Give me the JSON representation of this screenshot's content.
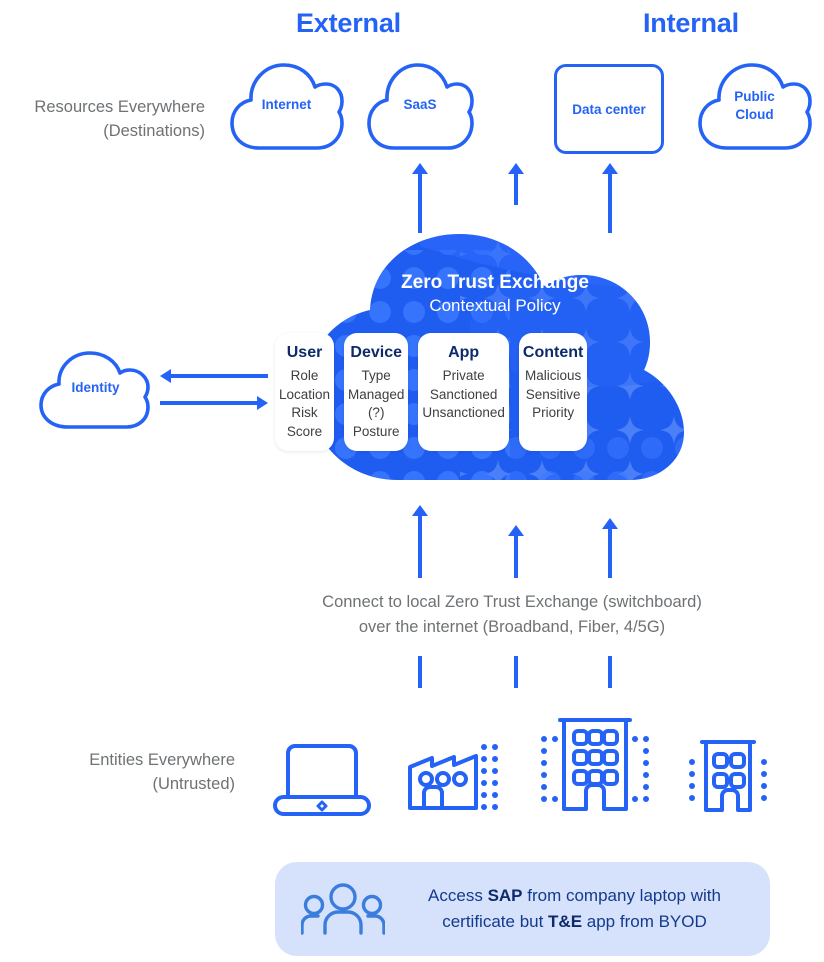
{
  "zones": {
    "external_label": "External",
    "internal_label": "Internal"
  },
  "rows": {
    "resources": {
      "line1": "Resources Everywhere",
      "line2": "(Destinations)"
    },
    "entities": {
      "line1": "Entities Everywhere",
      "line2": "(Untrusted)"
    }
  },
  "destinations": [
    {
      "id": "internet",
      "label": "Internet",
      "shape": "cloud"
    },
    {
      "id": "saas",
      "label": "SaaS",
      "shape": "cloud"
    },
    {
      "id": "datacenter",
      "label": "Data center",
      "shape": "rect"
    },
    {
      "id": "public-cloud",
      "label": "Public\nCloud",
      "shape": "cloud"
    }
  ],
  "destination_labels": {
    "internet": "Internet",
    "saas": "SaaS",
    "datacenter": "Data center",
    "public_cloud_line1": "Public",
    "public_cloud_line2": "Cloud"
  },
  "identity": {
    "label": "Identity"
  },
  "exchange": {
    "title": "Zero Trust Exchange",
    "subtitle": "Contextual Policy",
    "cards": [
      {
        "title": "User",
        "items": [
          "Role",
          "Location",
          "Risk Score"
        ]
      },
      {
        "title": "Device",
        "items": [
          "Type",
          "Managed (?)",
          "Posture"
        ]
      },
      {
        "title": "App",
        "items": [
          "Private",
          "Sanctioned",
          "Unsanctioned"
        ]
      },
      {
        "title": "Content",
        "items": [
          "Malicious",
          "Sensitive",
          "Priority"
        ]
      }
    ]
  },
  "connect_caption": {
    "line1": "Connect to local Zero Trust Exchange (switchboard)",
    "line2": "over the internet (Broadband, Fiber, 4/5G)"
  },
  "entities": [
    {
      "id": "laptop",
      "icon": "laptop-icon"
    },
    {
      "id": "factory",
      "icon": "factory-icon"
    },
    {
      "id": "building-lg",
      "icon": "office-building-icon"
    },
    {
      "id": "building-sm",
      "icon": "small-building-icon"
    }
  ],
  "callout": {
    "icon": "people-group-icon",
    "line1_pre": "Access ",
    "line1_bold": "SAP",
    "line1_post": " from company laptop with",
    "line2_pre": "certificate but ",
    "line2_bold": "T&E",
    "line2_post": " app from BYOD"
  },
  "colors": {
    "brand_blue": "#2463f5",
    "cloud_fill": "#1f5cf0",
    "cloud_fill_light": "#3a78ff",
    "card_title": "#0d2a6b",
    "card_text": "#3c4043",
    "gray_label": "#6e7275",
    "callout_bg": "#d6e2fb",
    "callout_text": "#123a8f",
    "background": "#ffffff"
  }
}
